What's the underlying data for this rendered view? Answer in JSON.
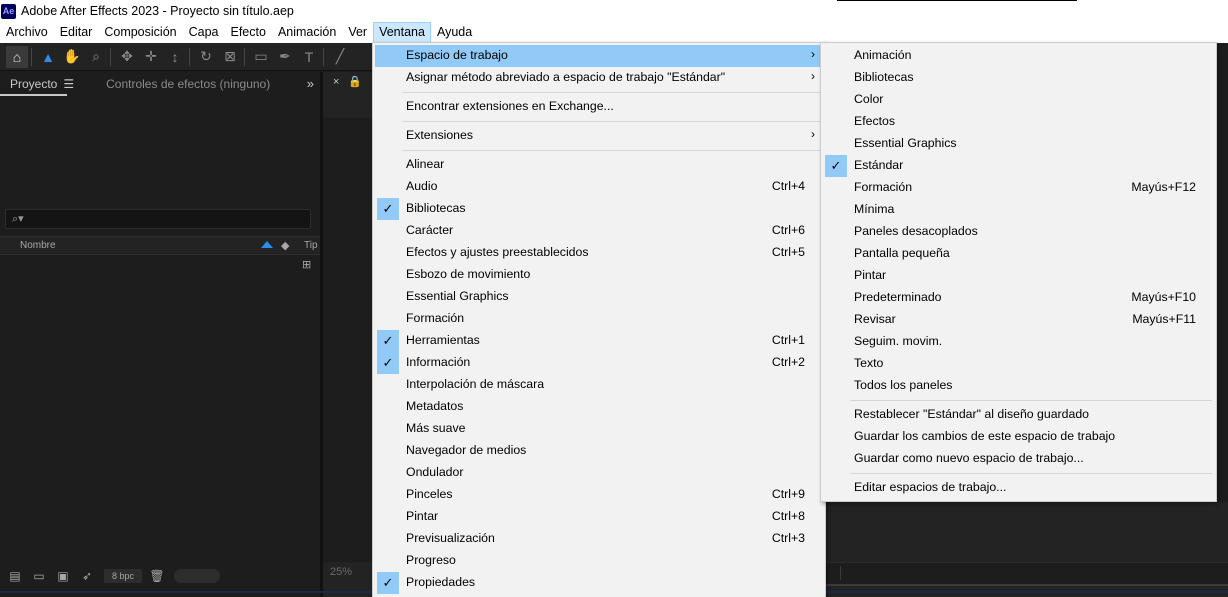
{
  "window": {
    "app_icon": "Ae",
    "title": "Adobe After Effects 2023 - Proyecto sin título.aep"
  },
  "menubar": {
    "items": [
      "Archivo",
      "Editar",
      "Composición",
      "Capa",
      "Efecto",
      "Animación",
      "Ver",
      "Ventana",
      "Ayuda"
    ],
    "active": "Ventana"
  },
  "project_panel": {
    "tabs": [
      "Proyecto",
      "Controles de efectos (ninguno)"
    ],
    "search_placeholder": "⌕▾",
    "column_name": "Nombre",
    "column_type": "Tip",
    "bpc": "8 bpc"
  },
  "comp_panel": {
    "zoom": "25%"
  },
  "window_menu": {
    "items": [
      {
        "label": "Espacio de trabajo",
        "submenu": true,
        "highlighted": true
      },
      {
        "label": "Asignar método abreviado a espacio de trabajo \"Estándar\"",
        "submenu": true
      },
      {
        "label": "Encontrar extensiones en Exchange..."
      },
      {
        "label": "Extensiones",
        "submenu": true
      },
      {
        "label": "Alinear"
      },
      {
        "label": "Audio",
        "shortcut": "Ctrl+4"
      },
      {
        "label": "Bibliotecas",
        "checked": true
      },
      {
        "label": "Carácter",
        "shortcut": "Ctrl+6"
      },
      {
        "label": "Efectos y ajustes preestablecidos",
        "shortcut": "Ctrl+5"
      },
      {
        "label": "Esbozo de movimiento"
      },
      {
        "label": "Essential Graphics"
      },
      {
        "label": "Formación"
      },
      {
        "label": "Herramientas",
        "shortcut": "Ctrl+1",
        "checked": true
      },
      {
        "label": "Información",
        "shortcut": "Ctrl+2",
        "checked": true
      },
      {
        "label": "Interpolación de máscara"
      },
      {
        "label": "Metadatos"
      },
      {
        "label": "Más suave"
      },
      {
        "label": "Navegador de medios"
      },
      {
        "label": "Ondulador"
      },
      {
        "label": "Pinceles",
        "shortcut": "Ctrl+9"
      },
      {
        "label": "Pintar",
        "shortcut": "Ctrl+8"
      },
      {
        "label": "Previsualización",
        "shortcut": "Ctrl+3"
      },
      {
        "label": "Progreso"
      },
      {
        "label": "Propiedades",
        "checked": true
      }
    ]
  },
  "workspace_submenu": {
    "items": [
      {
        "label": "Animación"
      },
      {
        "label": "Bibliotecas"
      },
      {
        "label": "Color"
      },
      {
        "label": "Efectos"
      },
      {
        "label": "Essential Graphics"
      },
      {
        "label": "Estándar",
        "checked": true
      },
      {
        "label": "Formación",
        "shortcut": "Mayús+F12"
      },
      {
        "label": "Mínima"
      },
      {
        "label": "Paneles desacoplados"
      },
      {
        "label": "Pantalla pequeña"
      },
      {
        "label": "Pintar"
      },
      {
        "label": "Predeterminado",
        "shortcut": "Mayús+F10"
      },
      {
        "label": "Revisar",
        "shortcut": "Mayús+F11"
      },
      {
        "label": "Seguim. movim."
      },
      {
        "label": "Texto"
      },
      {
        "label": "Todos los paneles"
      },
      {
        "label": "Restablecer \"Estándar\" al diseño guardado"
      },
      {
        "label": "Guardar los cambios de este espacio de trabajo"
      },
      {
        "label": "Guardar como nuevo espacio de trabajo..."
      },
      {
        "label": "Editar espacios de trabajo..."
      }
    ]
  },
  "icons": {
    "check": "✓",
    "submenu_arrow": "›"
  }
}
